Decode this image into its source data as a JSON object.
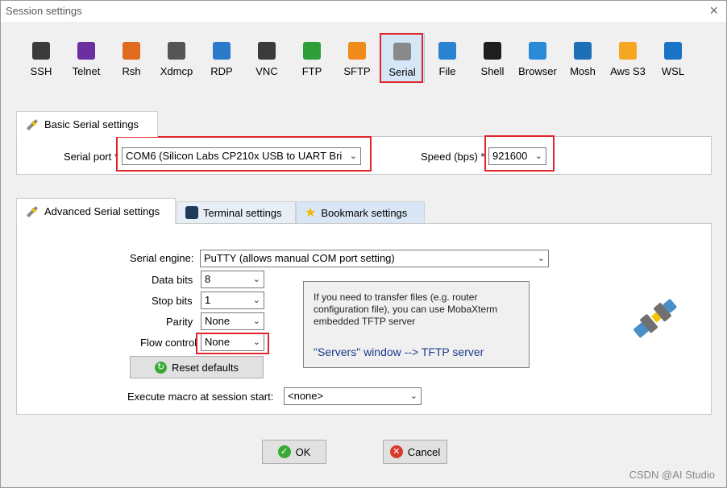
{
  "window": {
    "title": "Session settings",
    "close_glyph": "×"
  },
  "toolbar": {
    "items": [
      {
        "label": "SSH",
        "icon": "ssh-icon",
        "color": "#3b3b3b"
      },
      {
        "label": "Telnet",
        "icon": "telnet-icon",
        "color": "#6b2fa0"
      },
      {
        "label": "Rsh",
        "icon": "rsh-icon",
        "color": "#e06a1d"
      },
      {
        "label": "Xdmcp",
        "icon": "xdmcp-icon",
        "color": "#555555"
      },
      {
        "label": "RDP",
        "icon": "rdp-icon",
        "color": "#2a7ac9"
      },
      {
        "label": "VNC",
        "icon": "vnc-icon",
        "color": "#3a3a3a"
      },
      {
        "label": "FTP",
        "icon": "ftp-icon",
        "color": "#2e9e3a"
      },
      {
        "label": "SFTP",
        "icon": "sftp-icon",
        "color": "#f08a1a"
      },
      {
        "label": "Serial",
        "icon": "serial-plug-icon",
        "color": "#8a8a8a",
        "selected": true
      },
      {
        "label": "File",
        "icon": "file-icon",
        "color": "#2a82d0"
      },
      {
        "label": "Shell",
        "icon": "shell-icon",
        "color": "#1e1e1e"
      },
      {
        "label": "Browser",
        "icon": "browser-icon",
        "color": "#2a8ad8"
      },
      {
        "label": "Mosh",
        "icon": "mosh-icon",
        "color": "#1d6fb8"
      },
      {
        "label": "Aws S3",
        "icon": "aws-s3-icon",
        "color": "#f5a623"
      },
      {
        "label": "WSL",
        "icon": "wsl-icon",
        "color": "#1a73c6"
      }
    ]
  },
  "basic": {
    "tab_label": "Basic Serial settings",
    "serial_port_label": "Serial port *",
    "serial_port_value": "COM6  (Silicon Labs CP210x USB to UART Bri",
    "speed_label": "Speed (bps) *",
    "speed_value": "921600"
  },
  "advanced": {
    "tabs": {
      "advanced": "Advanced Serial settings",
      "terminal": "Terminal settings",
      "bookmark": "Bookmark settings"
    },
    "serial_engine_label": "Serial engine:",
    "serial_engine_value": "PuTTY    (allows manual COM port setting)",
    "data_bits_label": "Data bits",
    "data_bits_value": "8",
    "stop_bits_label": "Stop bits",
    "stop_bits_value": "1",
    "parity_label": "Parity",
    "parity_value": "None",
    "flow_control_label": "Flow control",
    "flow_control_value": "None",
    "reset_label": "Reset defaults",
    "info_text": "If you need to transfer files (e.g. router configuration file), you can use MobaXterm embedded TFTP server",
    "info_link": "\"Servers\" window  -->  TFTP server",
    "macro_label": "Execute macro at session start:",
    "macro_value": "<none>"
  },
  "footer": {
    "ok_label": "OK",
    "cancel_label": "Cancel",
    "watermark": "CSDN @AI Studio"
  },
  "colors": {
    "highlight": "#e0242b",
    "accent": "#1a3a8a"
  }
}
